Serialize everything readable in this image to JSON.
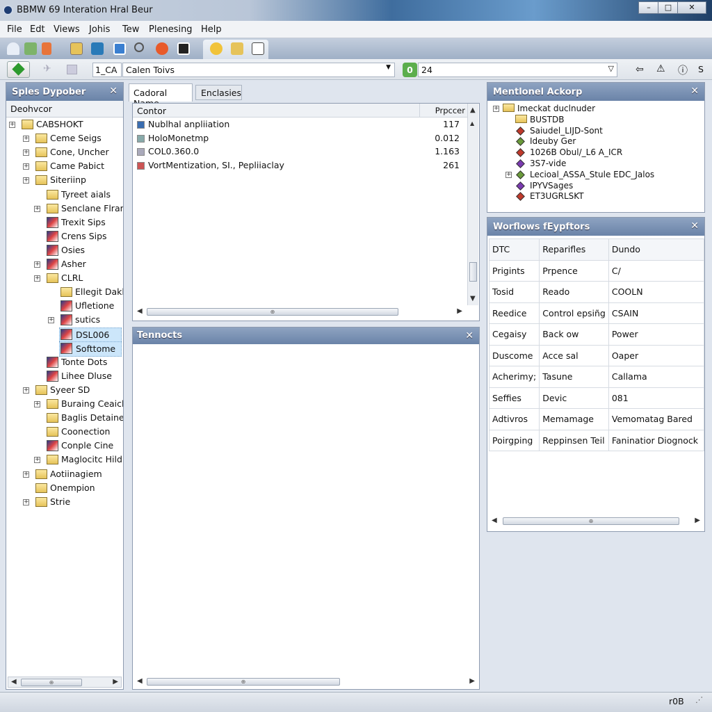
{
  "window": {
    "title": "BBMW 69 Interation Hral Beur",
    "min": "–",
    "max": "□",
    "close": "✕"
  },
  "menu": [
    "File",
    "Edt",
    "Views",
    "Johis",
    "Tew",
    "Plenesing",
    "Help"
  ],
  "toolbar": {
    "icons": [
      "home-icon",
      "network-icon",
      "tools-icon",
      "folder-image-icon",
      "chart-icon",
      "window-icon",
      "search-icon",
      "settings-icon",
      "media-icon",
      "help-icon",
      "tree-icon",
      "document-icon"
    ]
  },
  "address": {
    "prefix": "1_CA",
    "value": "Calen Toivs",
    "search_value": "24",
    "icons": [
      "back-arrow-icon",
      "warning-icon",
      "info-icon"
    ],
    "extra": "S"
  },
  "left_panel": {
    "title": "Sples Dypober",
    "close": "✕",
    "subheader": "Deohvcor",
    "tree": [
      {
        "label": "CABSHOKT",
        "level": 0,
        "icon": "folder",
        "expand": true
      },
      {
        "label": "Ceme Seigs",
        "level": 1,
        "icon": "folder",
        "expand": true
      },
      {
        "label": "Cone, Uncher",
        "level": 1,
        "icon": "folder",
        "expand": true
      },
      {
        "label": "Came Pabict",
        "level": 1,
        "icon": "folder",
        "expand": true
      },
      {
        "label": "Siteriinp",
        "level": 1,
        "icon": "folder",
        "expand": true
      },
      {
        "label": "Tyreet aials",
        "level": 2,
        "icon": "folder",
        "expand": false
      },
      {
        "label": "Senclane Flran",
        "level": 2,
        "icon": "folder",
        "expand": true
      },
      {
        "label": "Trexit Sips",
        "level": 2,
        "icon": "image",
        "expand": false
      },
      {
        "label": "Crens Sips",
        "level": 2,
        "icon": "image",
        "expand": false
      },
      {
        "label": "Osies",
        "level": 2,
        "icon": "image",
        "expand": false
      },
      {
        "label": "Asher",
        "level": 2,
        "icon": "image",
        "expand": true
      },
      {
        "label": "CLRL",
        "level": 2,
        "icon": "folder",
        "expand": true
      },
      {
        "label": "Ellegit Daklc",
        "level": 3,
        "icon": "folder",
        "expand": false
      },
      {
        "label": "Ufletione",
        "level": 3,
        "icon": "image",
        "expand": false
      },
      {
        "label": "sutics",
        "level": 3,
        "icon": "image",
        "expand": true
      },
      {
        "label": "DSL006",
        "level": 3,
        "icon": "image",
        "expand": false,
        "selected": true
      },
      {
        "label": "Softtome",
        "level": 3,
        "icon": "image",
        "expand": false,
        "selected": true
      },
      {
        "label": "Tonte Dots",
        "level": 2,
        "icon": "image",
        "expand": false
      },
      {
        "label": "Lihee Dluse",
        "level": 2,
        "icon": "image",
        "expand": false
      },
      {
        "label": "Syeer SD",
        "level": 1,
        "icon": "folder",
        "expand": true
      },
      {
        "label": "Buraing Ceaich",
        "level": 2,
        "icon": "folder",
        "expand": true
      },
      {
        "label": "Baglis Detained",
        "level": 2,
        "icon": "folder",
        "expand": false
      },
      {
        "label": "Coonection",
        "level": 2,
        "icon": "folder",
        "expand": false
      },
      {
        "label": "Conple Cine",
        "level": 2,
        "icon": "image",
        "expand": false
      },
      {
        "label": "Maglocitc Hildn",
        "level": 2,
        "icon": "folder",
        "expand": true
      },
      {
        "label": "Aotiinagiem",
        "level": 1,
        "icon": "folder",
        "expand": true
      },
      {
        "label": "Onempion",
        "level": 1,
        "icon": "folder",
        "expand": false
      },
      {
        "label": "Strie",
        "level": 1,
        "icon": "folder",
        "expand": true
      }
    ]
  },
  "center": {
    "tabs": [
      "Cadoral Name",
      "Enclasies"
    ],
    "columns": [
      "Contor",
      "Prpccer"
    ],
    "rows": [
      [
        "Nublhal anpliiation",
        "117"
      ],
      [
        "HoloMonetmp",
        "0.012"
      ],
      [
        "COL0.360.0",
        "1.163"
      ],
      [
        "VortMentization, SI., Pepliiaclay",
        "261"
      ]
    ],
    "bottom_title": "Tennocts",
    "close": "✕"
  },
  "right_top": {
    "title": "Mentlonel Ackorp",
    "close": "✕",
    "tree": [
      {
        "label": "Imeckat duclnuder",
        "kind": "folder",
        "expand": true
      },
      {
        "label": "BUSTDB",
        "kind": "folder-open"
      },
      {
        "label": "Saiudel_LIJD-Sont",
        "kind": "diamond",
        "color": "#c0392b"
      },
      {
        "label": "Ideuby Ger",
        "kind": "diamond",
        "color": "#6a9a3a"
      },
      {
        "label": "1026B Obul/_L6 A_ICR",
        "kind": "diamond",
        "color": "#c0392b"
      },
      {
        "label": "3S7-vide",
        "kind": "diamond",
        "color": "#7a3ab0"
      },
      {
        "label": "Lecioal_ASSA_Stule EDC_Jalos",
        "kind": "diamond",
        "color": "#6a9a3a",
        "expand": true
      },
      {
        "label": "IPYVSages",
        "kind": "diamond",
        "color": "#7a3ab0"
      },
      {
        "label": "ET3UGRLSKT",
        "kind": "diamond",
        "color": "#c0392b"
      }
    ]
  },
  "right_bottom": {
    "title": "Worflows fEypftors",
    "close": "✕",
    "columns": [
      "DTC",
      "Reparifles",
      "Dundo"
    ],
    "rows": [
      [
        "Prigints",
        "Prpence",
        "C/"
      ],
      [
        "Tosid",
        "Reado",
        "COOLN"
      ],
      [
        "Reedice",
        "Control epsiñg",
        "CSAIN"
      ],
      [
        "Cegaisy",
        "Back ow",
        "Power"
      ],
      [
        "Duscome",
        "Acce sal",
        "Oaper"
      ],
      [
        "Acherimy;",
        "Tasune",
        "Callama"
      ],
      [
        "Seffies",
        "Devic",
        "081"
      ],
      [
        "Adtivros",
        "Memamage",
        "Vemomatag Bared"
      ],
      [
        "Poirgping",
        "Reppinsen Teil",
        "Faninatior Diognock"
      ]
    ]
  },
  "status": {
    "text": "r0B",
    "icon": "resize-grip-icon"
  },
  "scroll_thumb": "⊕"
}
